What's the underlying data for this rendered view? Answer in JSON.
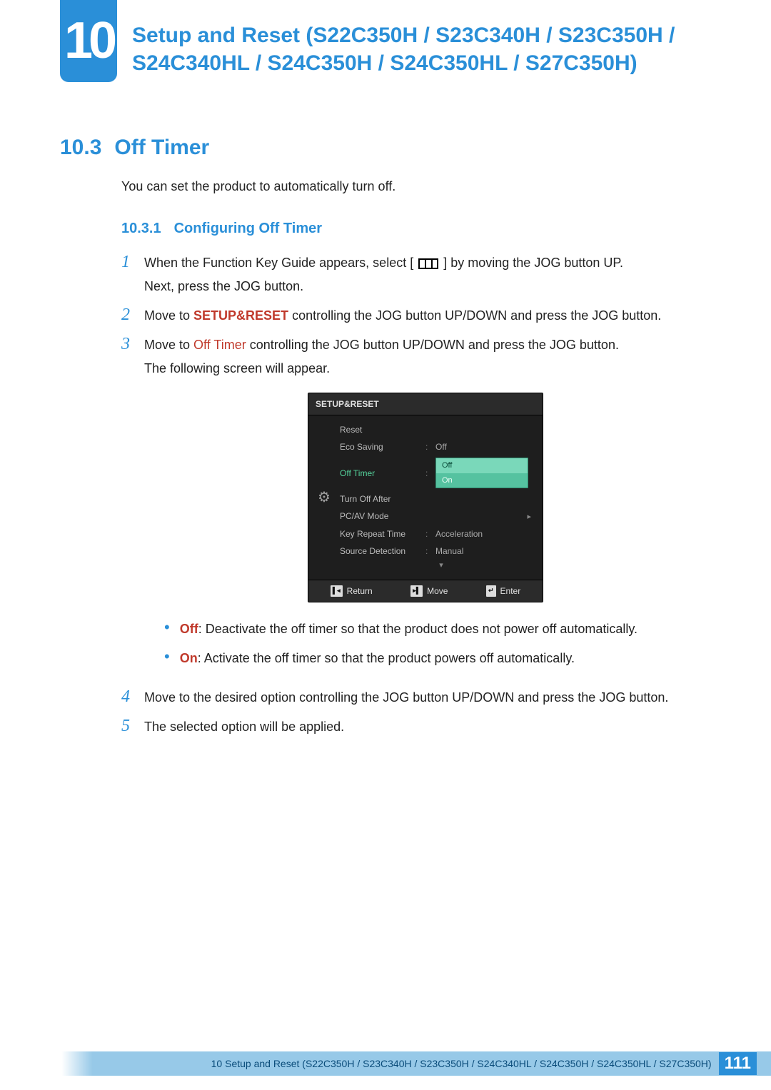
{
  "chapter": {
    "number": "10",
    "title": "Setup and Reset (S22C350H / S23C340H / S23C350H / S24C340HL / S24C350H / S24C350HL / S27C350H)"
  },
  "section": {
    "number": "10.3",
    "title": "Off Timer"
  },
  "intro": "You can set the product to automatically turn off.",
  "subsection": {
    "number": "10.3.1",
    "title": "Configuring Off Timer"
  },
  "steps": {
    "s1a": "When the Function Key Guide appears, select [",
    "s1b": "] by moving the JOG button UP.",
    "s1_line2": "Next, press the JOG button.",
    "s2a": "Move to ",
    "s2_hl": "SETUP&RESET",
    "s2b": " controlling the JOG button UP/DOWN and press the JOG button.",
    "s3a": "Move to ",
    "s3_hl": "Off Timer",
    "s3b": " controlling the JOG button UP/DOWN and press the JOG button.",
    "s3_line2": "The following screen will appear.",
    "s4": "Move to the desired option controlling the JOG button UP/DOWN and press the JOG button.",
    "s5": "The selected option will be applied."
  },
  "osd": {
    "header": "SETUP&RESET",
    "items": {
      "reset": "Reset",
      "eco_saving": "Eco Saving",
      "eco_saving_val": "Off",
      "off_timer": "Off Timer",
      "turn_off_after": "Turn Off After",
      "pcav_mode": "PC/AV Mode",
      "key_repeat": "Key Repeat Time",
      "key_repeat_val": "Acceleration",
      "source_detection": "Source Detection",
      "source_detection_val": "Manual"
    },
    "popup": {
      "opt_off": "Off",
      "opt_on": "On"
    },
    "footer": {
      "return": "Return",
      "move": "Move",
      "enter": "Enter"
    }
  },
  "bullets": {
    "off_label": "Off",
    "off_text": ": Deactivate the off timer so that the product does not power off automatically.",
    "on_label": "On",
    "on_text": ": Activate the off timer so that the product powers off automatically."
  },
  "footer": {
    "text": "10 Setup and Reset (S22C350H / S23C340H / S23C350H / S24C340HL / S24C350H / S24C350HL / S27C350H)",
    "page": "111"
  },
  "nums": {
    "n1": "1",
    "n2": "2",
    "n3": "3",
    "n4": "4",
    "n5": "5"
  }
}
